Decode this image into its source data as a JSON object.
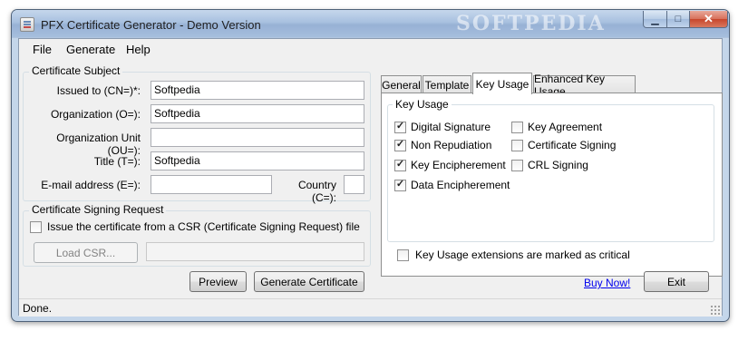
{
  "window": {
    "title": "PFX Certificate Generator - Demo Version",
    "watermark": "SOFTPEDIA",
    "minimize_glyph": "▁",
    "maximize_glyph": "□",
    "close_glyph": "✕"
  },
  "menu": [
    "File",
    "Generate",
    "Help"
  ],
  "subject": {
    "group_title": "Certificate Subject",
    "fields": {
      "cn_label": "Issued to (CN=)*:",
      "cn_value": "Softpedia",
      "o_label": "Organization (O=):",
      "o_value": "Softpedia",
      "ou_label": "Organization Unit (OU=):",
      "ou_value": "",
      "t_label": "Title (T=):",
      "t_value": "Softpedia",
      "e_label": "E-mail address (E=):",
      "e_value": "",
      "c_label": "Country (C=):",
      "c_value": ""
    }
  },
  "csr": {
    "group_title": "Certificate Signing Request",
    "checkbox_label": "Issue the certificate from a CSR (Certificate Signing Request) file",
    "checked": false,
    "load_button": "Load CSR...",
    "path_value": ""
  },
  "buttons": {
    "preview": "Preview",
    "generate": "Generate Certificate",
    "exit": "Exit",
    "buy": "Buy Now!"
  },
  "tabs": [
    "General",
    "Template",
    "Key Usage",
    "Enhanced Key Usage"
  ],
  "active_tab": "Key Usage",
  "key_usage": {
    "group_title": "Key Usage",
    "left": [
      {
        "label": "Digital Signature",
        "checked": true
      },
      {
        "label": "Non Repudiation",
        "checked": true
      },
      {
        "label": "Key Encipherement",
        "checked": true
      },
      {
        "label": "Data Encipherement",
        "checked": true
      }
    ],
    "right": [
      {
        "label": "Key Agreement",
        "checked": false
      },
      {
        "label": "Certificate Signing",
        "checked": false
      },
      {
        "label": "CRL Signing",
        "checked": false
      }
    ],
    "critical_label": "Key Usage extensions are marked as critical",
    "critical_checked": false
  },
  "status": {
    "text": "Done."
  }
}
